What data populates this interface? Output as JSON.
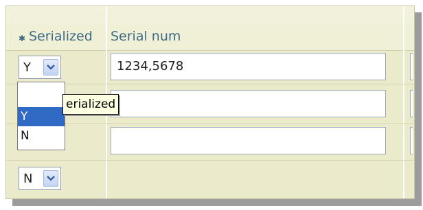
{
  "table": {
    "headers": {
      "serialized": "Serialized",
      "serial_num": "Serial num"
    },
    "rows": [
      {
        "serialized": "Y",
        "serial_num": "1234,5678"
      },
      {
        "serialized": "",
        "serial_num": ""
      },
      {
        "serialized": "",
        "serial_num": ""
      },
      {
        "serialized": "N",
        "serial_num": ""
      }
    ]
  },
  "dropdown": {
    "options": [
      "",
      "Y",
      "N"
    ],
    "selected": "Y"
  },
  "tooltip": {
    "text": "erialized"
  },
  "icons": {
    "required": "asterisk-icon",
    "dropdown_arrow": "chevron-down-icon"
  },
  "colors": {
    "header_text": "#3d6a86",
    "selection": "#316ac5",
    "table_background": "#ebebcc"
  }
}
